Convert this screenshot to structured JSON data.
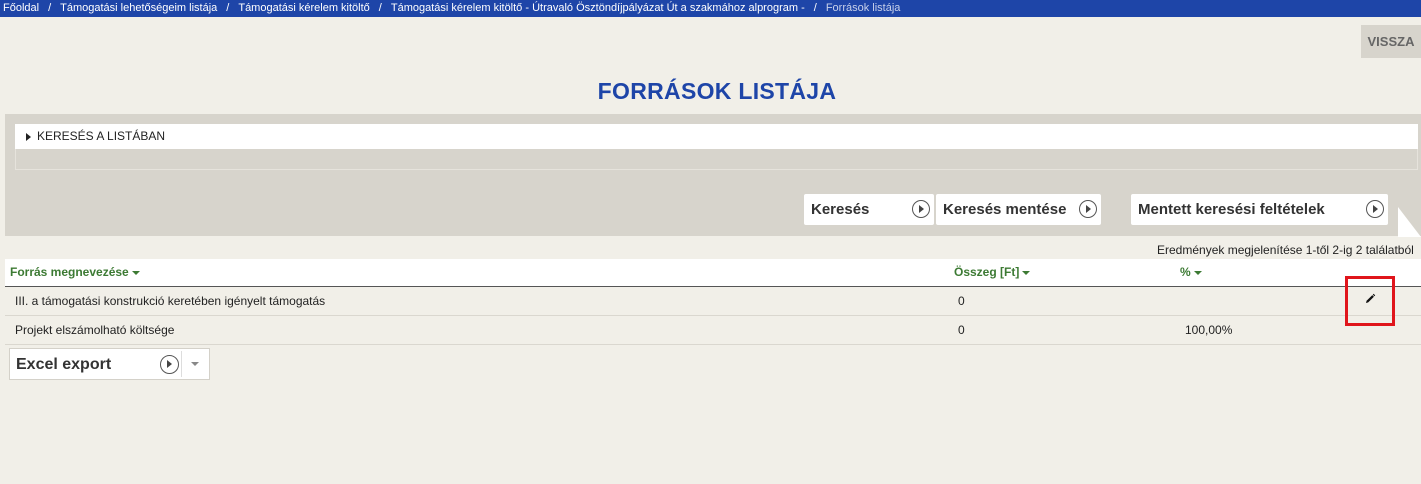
{
  "breadcrumb": {
    "items": [
      "Főoldal",
      "Támogatási lehetőségeim listája",
      "Támogatási kérelem kitöltő",
      "Támogatási kérelem kitöltő - Útravaló Ösztöndíjpályázat Út a szakmához alprogram -"
    ],
    "current": "Források listája",
    "separator": "/"
  },
  "back_button": "VISSZA",
  "page_title": "FORRÁSOK LISTÁJA",
  "search": {
    "toggle_label": "KERESÉS A LISTÁBAN",
    "search_button": "Keresés",
    "save_search_button": "Keresés mentése",
    "saved_filters_button": "Mentett keresési feltételek"
  },
  "results_info": "Eredmények megjelenítése 1-től 2-ig 2 találatból",
  "table": {
    "columns": [
      "Forrás megnevezése",
      "Összeg [Ft]",
      "%"
    ],
    "rows": [
      {
        "name": "III. a támogatási konstrukció keretében igényelt támogatás",
        "amount": "0",
        "percent": ""
      },
      {
        "name": "Projekt elszámolható költsége",
        "amount": "0",
        "percent": "100,00%"
      }
    ]
  },
  "export": {
    "label": "Excel export"
  },
  "colors": {
    "brand_blue": "#1e45a8",
    "header_green": "#3c7a33",
    "highlight_red": "#e0151b",
    "background": "#f1efe8",
    "panel_gray": "#d7d4cc"
  },
  "icons": {
    "edit": "pencil-icon",
    "play": "circle-play-icon",
    "dropdown": "chevron-down-icon",
    "toggle": "triangle-right-icon",
    "sort": "sort-down-icon"
  }
}
